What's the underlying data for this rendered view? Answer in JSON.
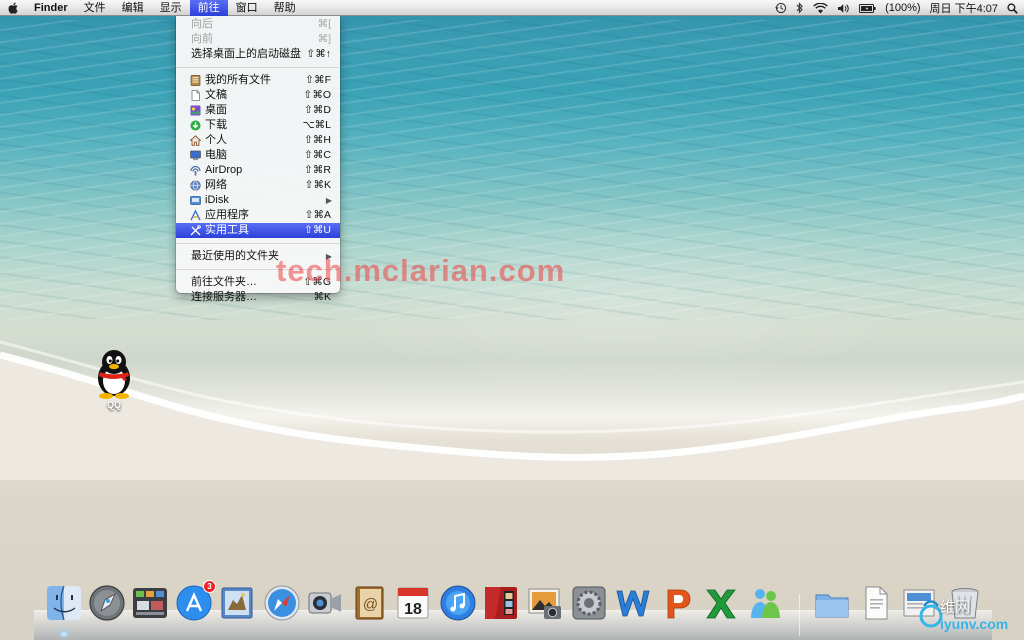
{
  "menubar": {
    "apple_icon": "apple-icon",
    "app_name": "Finder",
    "menus": [
      "文件",
      "编辑",
      "显示",
      "前往",
      "窗口",
      "帮助"
    ],
    "active_menu": "前往",
    "status": {
      "battery": "(100%)",
      "datetime": "周日 下午4:07"
    }
  },
  "go_menu": {
    "items": [
      {
        "label": "向后",
        "shortcut": "⌘[",
        "disabled": true
      },
      {
        "label": "向前",
        "shortcut": "⌘]",
        "disabled": true
      },
      {
        "label": "选择桌面上的启动磁盘",
        "shortcut": "⇧⌘↑"
      },
      {
        "label": "我的所有文件",
        "shortcut": "⇧⌘F",
        "icon": "all-files-icon"
      },
      {
        "label": "文稿",
        "shortcut": "⇧⌘O",
        "icon": "documents-icon"
      },
      {
        "label": "桌面",
        "shortcut": "⇧⌘D",
        "icon": "desktop-folder-icon"
      },
      {
        "label": "下载",
        "shortcut": "⌥⌘L",
        "icon": "downloads-icon"
      },
      {
        "label": "个人",
        "shortcut": "⇧⌘H",
        "icon": "home-icon"
      },
      {
        "label": "电脑",
        "shortcut": "⇧⌘C",
        "icon": "computer-icon"
      },
      {
        "label": "AirDrop",
        "shortcut": "⇧⌘R",
        "icon": "airdrop-icon"
      },
      {
        "label": "网络",
        "shortcut": "⇧⌘K",
        "icon": "network-icon"
      },
      {
        "label": "iDisk",
        "submenu": "▶",
        "icon": "idisk-icon"
      },
      {
        "label": "应用程序",
        "shortcut": "⇧⌘A",
        "icon": "applications-icon"
      },
      {
        "label": "实用工具",
        "shortcut": "⇧⌘U",
        "icon": "utilities-icon",
        "highlighted": true
      },
      {
        "label": "最近使用的文件夹",
        "submenu": "▶"
      },
      {
        "label": "前往文件夹…",
        "shortcut": "⇧⌘G"
      },
      {
        "label": "连接服务器…",
        "shortcut": "⌘K"
      }
    ]
  },
  "watermark": "tech.mclarian.com",
  "desktop_icons": [
    {
      "label": "QQ",
      "icon": "qq-penguin-icon"
    }
  ],
  "dock": {
    "apps": [
      {
        "name": "Finder",
        "icon": "finder-icon",
        "running": true
      },
      {
        "name": "Launchpad",
        "icon": "launchpad-icon"
      },
      {
        "name": "Mission Control",
        "icon": "mission-control-icon"
      },
      {
        "name": "App Store",
        "icon": "app-store-icon",
        "badge": "3"
      },
      {
        "name": "Mail",
        "icon": "mail-icon"
      },
      {
        "name": "Safari",
        "icon": "safari-icon"
      },
      {
        "name": "FaceTime",
        "icon": "facetime-icon"
      },
      {
        "name": "Address Book",
        "icon": "address-book-icon"
      },
      {
        "name": "iCal",
        "icon": "calendar-icon",
        "date": "18"
      },
      {
        "name": "iTunes",
        "icon": "itunes-icon"
      },
      {
        "name": "Photo Booth",
        "icon": "photo-booth-icon"
      },
      {
        "name": "iPhoto",
        "icon": "iphoto-icon"
      },
      {
        "name": "System Preferences",
        "icon": "system-preferences-icon"
      },
      {
        "name": "Word",
        "icon": "word-icon"
      },
      {
        "name": "PowerPoint",
        "icon": "powerpoint-icon"
      },
      {
        "name": "Excel",
        "icon": "excel-icon"
      },
      {
        "name": "Messenger",
        "icon": "messenger-icon"
      }
    ],
    "stacks": [
      {
        "name": "Applications",
        "icon": "applications-stack-icon"
      },
      {
        "name": "Documents",
        "icon": "documents-stack-icon"
      },
      {
        "name": "Downloads",
        "icon": "downloads-stack-icon"
      },
      {
        "name": "Trash",
        "icon": "trash-icon"
      }
    ]
  },
  "site_mark": {
    "cn": "维网",
    "en": "iyunv.com"
  },
  "colors": {
    "menu_highlight": "#3d52e6",
    "watermark": "#ec4242",
    "site_mark_blue": "#38b4e8"
  }
}
